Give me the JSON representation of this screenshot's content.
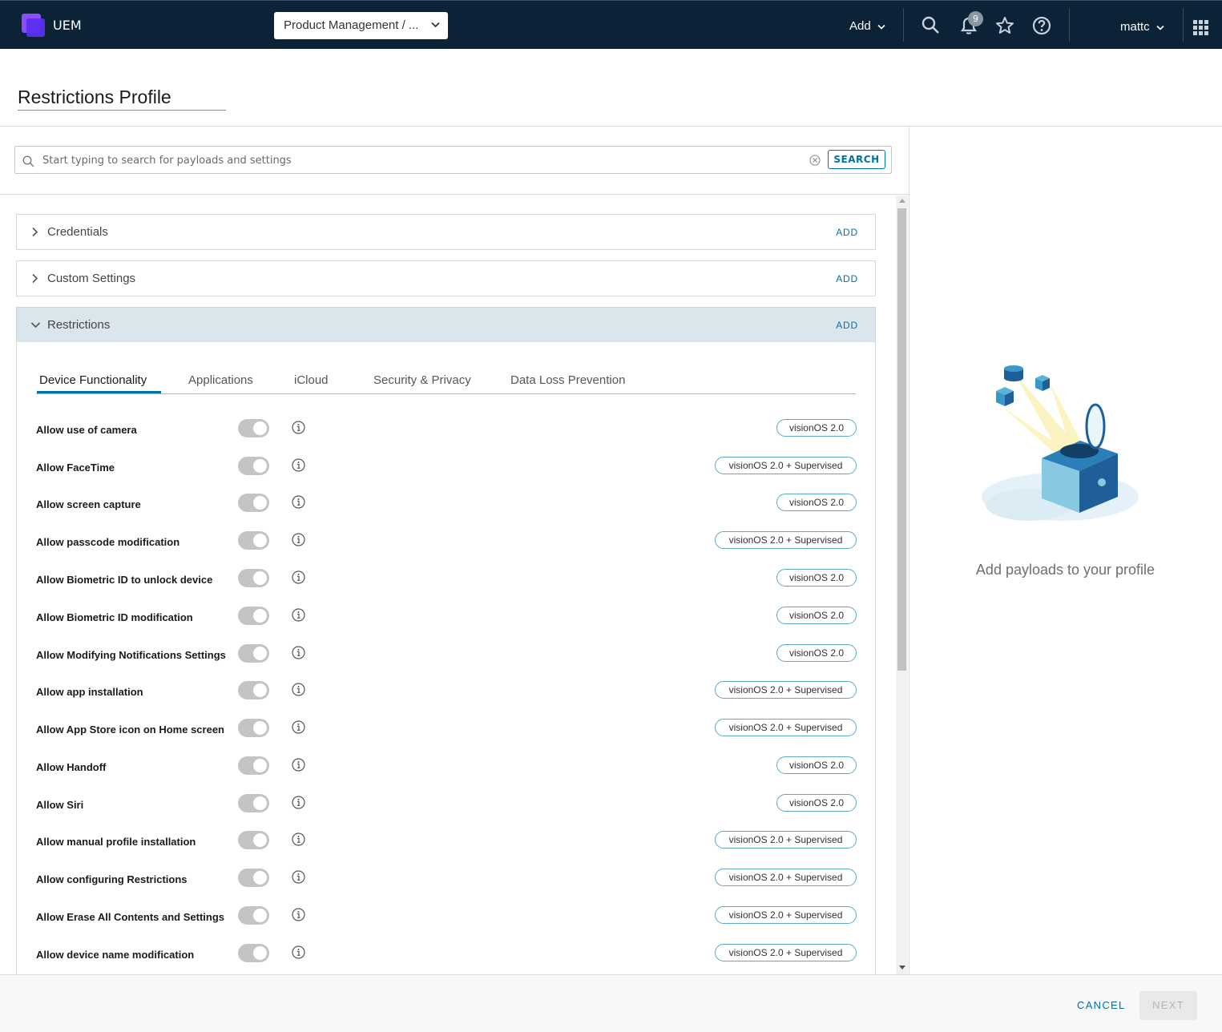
{
  "header": {
    "app_name": "UEM",
    "org_group": "Product Management / ...",
    "add_label": "Add",
    "notification_count": "9",
    "user": "mattc"
  },
  "profile": {
    "title": "Restrictions Profile"
  },
  "search": {
    "placeholder": "Start typing to search for payloads and settings",
    "button_label": "SEARCH"
  },
  "payloads": [
    {
      "label": "Credentials",
      "add": "ADD",
      "expanded": false
    },
    {
      "label": "Custom Settings",
      "add": "ADD",
      "expanded": false
    },
    {
      "label": "Restrictions",
      "add": "ADD",
      "expanded": true
    }
  ],
  "tabs": [
    {
      "label": "Device Functionality",
      "active": true
    },
    {
      "label": "Applications",
      "active": false
    },
    {
      "label": "iCloud",
      "active": false
    },
    {
      "label": "Security & Privacy",
      "active": false
    },
    {
      "label": "Data Loss Prevention",
      "active": false
    }
  ],
  "settings": [
    {
      "label": "Allow use of camera",
      "badge": "visionOS 2.0",
      "enabled": true
    },
    {
      "label": "Allow FaceTime",
      "badge": "visionOS 2.0 + Supervised",
      "enabled": true
    },
    {
      "label": "Allow screen capture",
      "badge": "visionOS 2.0",
      "enabled": true
    },
    {
      "label": "Allow passcode modification",
      "badge": "visionOS 2.0 + Supervised",
      "enabled": true
    },
    {
      "label": "Allow Biometric ID to unlock device",
      "badge": "visionOS 2.0",
      "enabled": true
    },
    {
      "label": "Allow Biometric ID modification",
      "badge": "visionOS 2.0",
      "enabled": true
    },
    {
      "label": "Allow Modifying Notifications Settings",
      "badge": "visionOS 2.0",
      "enabled": true
    },
    {
      "label": "Allow app installation",
      "badge": "visionOS 2.0 + Supervised",
      "enabled": true
    },
    {
      "label": "Allow App Store icon on Home screen",
      "badge": "visionOS 2.0 + Supervised",
      "enabled": true
    },
    {
      "label": "Allow Handoff",
      "badge": "visionOS 2.0",
      "enabled": true
    },
    {
      "label": "Allow Siri",
      "badge": "visionOS 2.0",
      "enabled": true
    },
    {
      "label": "Allow manual profile installation",
      "badge": "visionOS 2.0 + Supervised",
      "enabled": true
    },
    {
      "label": "Allow configuring Restrictions",
      "badge": "visionOS 2.0 + Supervised",
      "enabled": true
    },
    {
      "label": "Allow Erase All Contents and Settings",
      "badge": "visionOS 2.0 + Supervised",
      "enabled": true
    },
    {
      "label": "Allow device name modification",
      "badge": "visionOS 2.0 + Supervised",
      "enabled": true
    }
  ],
  "empty_state": {
    "text": "Add payloads to your profile"
  },
  "footer": {
    "cancel": "CANCEL",
    "next": "NEXT"
  },
  "colors": {
    "header_bg": "#0c2236",
    "accent": "#0072a3",
    "badge_border": "#5aa9c7",
    "open_accordion_bg": "#dbe5ec"
  }
}
